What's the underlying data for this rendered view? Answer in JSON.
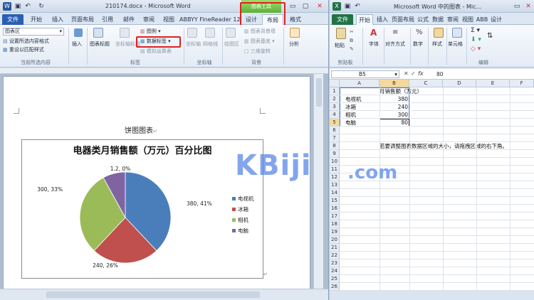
{
  "word": {
    "title": "210174.docx - Microsoft Word",
    "context_tab_label": "图表工具",
    "tabs": [
      "文件",
      "开始",
      "插入",
      "页面布局",
      "引用",
      "邮件",
      "审阅",
      "视图",
      "ABBYY FineReader 12",
      "设计",
      "布局",
      "格式"
    ],
    "selected_tab": "布局",
    "ribbon": {
      "element_selector": "图表区",
      "format_selection": "设置所选内容格式",
      "reset_style": "重设以匹配样式",
      "group_current": "当前所选内容",
      "insert": "插入",
      "chart_title": "图表标题",
      "axis_titles": "坐标轴标题",
      "legend": "图例",
      "data_labels": "数据标签",
      "data_table": "模拟运算表",
      "group_labels": "标签",
      "axes": "坐标轴",
      "gridlines": "网格线",
      "group_axes": "坐标轴",
      "plot_area": "绘图区",
      "chart_wall": "图表背景墙",
      "chart_floor": "图表基底",
      "rotation": "三维旋转",
      "group_background": "背景",
      "analysis": "分析"
    },
    "doc": {
      "caption": "饼图图表",
      "chart_data": {
        "type": "pie",
        "title": "电器类月销售额（万元）百分比图",
        "categories": [
          "电视机",
          "冰箱",
          "相机",
          "电脑"
        ],
        "values": [
          380,
          240,
          300,
          80
        ],
        "data_labels": [
          "380, 41%",
          "240, 26%",
          "300, 33%",
          "1.2, 0%"
        ],
        "colors": [
          "#4a7ebb",
          "#c0504d",
          "#9bbb59",
          "#8064a2"
        ],
        "legend_position": "right"
      }
    }
  },
  "excel": {
    "title": "Microsoft Word 中的图表 - Mic...",
    "tabs": [
      "文件",
      "开始",
      "插入",
      "页面布局",
      "公式",
      "数据",
      "审阅",
      "视图",
      "ABB",
      "设计"
    ],
    "selected_tab": "开始",
    "ribbon": {
      "paste": "粘贴",
      "clipboard": "剪贴板",
      "font": "字体",
      "alignment": "对齐方式",
      "number": "数字",
      "styles": "样式",
      "cells": "单元格",
      "editing": "编辑"
    },
    "name_box": "B5",
    "formula": "80",
    "columns": [
      "A",
      "B",
      "C",
      "D",
      "E",
      "F"
    ],
    "rows": [
      "1",
      "2",
      "3",
      "4",
      "5",
      "6",
      "7",
      "8",
      "9",
      "10",
      "11",
      "12",
      "13",
      "14",
      "15",
      "16",
      "17",
      "18",
      "19",
      "20",
      "21",
      "22",
      "23",
      "24",
      "25",
      "26"
    ],
    "header_cell": "月销售额（万元）",
    "items": [
      {
        "label": "电视机",
        "value": "380"
      },
      {
        "label": "冰箱",
        "value": "240"
      },
      {
        "label": "相机",
        "value": "300"
      },
      {
        "label": "电脑",
        "value": "80"
      }
    ],
    "hint": "若要调整图表数据区域的大小，请拖拽区域的右下角。"
  },
  "watermark": {
    "main": "KBiji",
    "suffix": ".com"
  }
}
